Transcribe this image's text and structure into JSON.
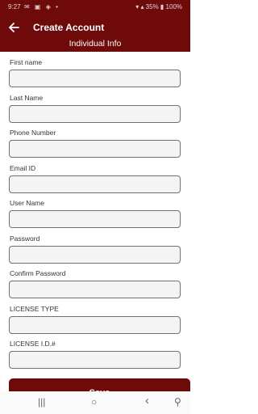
{
  "status_bar": {
    "time": "9:27",
    "left_icons": "✉ ▣ ◈ •",
    "right_icons": "▾ ▴ 35% ▮ 100%"
  },
  "app_bar": {
    "title": "Create Account",
    "subtitle": "Individual Info"
  },
  "fields": [
    {
      "label": "First name",
      "value": ""
    },
    {
      "label": "Last Name",
      "value": ""
    },
    {
      "label": "Phone Number",
      "value": ""
    },
    {
      "label": "Email ID",
      "value": ""
    },
    {
      "label": "User Name",
      "value": ""
    },
    {
      "label": "Password",
      "value": ""
    },
    {
      "label": "Confirm Password",
      "value": ""
    },
    {
      "label": "LICENSE TYPE",
      "value": ""
    },
    {
      "label": "LICENSE I.D.#",
      "value": ""
    }
  ],
  "save_label": "Save",
  "nav": {
    "recents": "|||",
    "home": "○",
    "back": "‹",
    "accessibility": "⚲"
  },
  "colors": {
    "primary": "#6e0a0a",
    "field_bg": "#f4f4f4",
    "field_border": "#707070"
  }
}
